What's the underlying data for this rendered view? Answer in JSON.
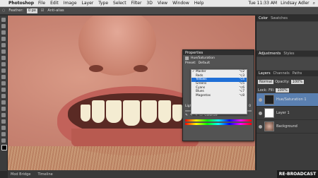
{
  "menubar": {
    "app_name": "Photoshop",
    "items": [
      "File",
      "Edit",
      "Image",
      "Layer",
      "Type",
      "Select",
      "Filter",
      "3D",
      "View",
      "Window",
      "Help"
    ],
    "clock": "Tue 11:33 AM",
    "user": "Lindsay Adler"
  },
  "options_bar": {
    "feather_label": "Feather:",
    "feather_value": "0 px",
    "anti_alias": "Anti-alias"
  },
  "tabbar": {
    "tabs": [
      "Mod Bridge",
      "Timeline"
    ]
  },
  "dock": {
    "tabs_top": [
      "Color",
      "Swatches"
    ],
    "tabs_mid": [
      "Adjustments",
      "Styles"
    ],
    "tabs_layers": [
      "Layers",
      "Channels",
      "Paths"
    ],
    "blend_mode": "Normal",
    "opacity_label": "Opacity:",
    "opacity_value": "100%",
    "lock_label": "Lock:",
    "fill_label": "Fill:",
    "fill_value": "100%",
    "layers": [
      {
        "name": "Hue/Saturation 1",
        "thumb": "adjust",
        "active": true
      },
      {
        "name": "Layer 1",
        "thumb": "white",
        "active": false
      },
      {
        "name": "Background",
        "thumb": "photo",
        "active": false
      }
    ]
  },
  "properties": {
    "title": "Properties",
    "subtitle": "Hue/Saturation",
    "preset_label": "Preset:",
    "preset_value": "Default",
    "lightness_label": "Lightness:",
    "lightness_value": "0",
    "colorize_label": "Colorize",
    "menu": [
      {
        "label": "Master",
        "shortcut": "⌥2",
        "checked": true,
        "selected": false
      },
      {
        "label": "Reds",
        "shortcut": "⌥3",
        "checked": false,
        "selected": false
      },
      {
        "label": "Yellows",
        "shortcut": "⌥4",
        "checked": false,
        "selected": true
      },
      {
        "label": "Greens",
        "shortcut": "⌥5",
        "checked": false,
        "selected": false
      },
      {
        "label": "Cyans",
        "shortcut": "⌥6",
        "checked": false,
        "selected": false
      },
      {
        "label": "Blues",
        "shortcut": "⌥7",
        "checked": false,
        "selected": false
      },
      {
        "label": "Magentas",
        "shortcut": "⌥8",
        "checked": false,
        "selected": false
      }
    ]
  },
  "watermark": "RE-BROADCAST"
}
